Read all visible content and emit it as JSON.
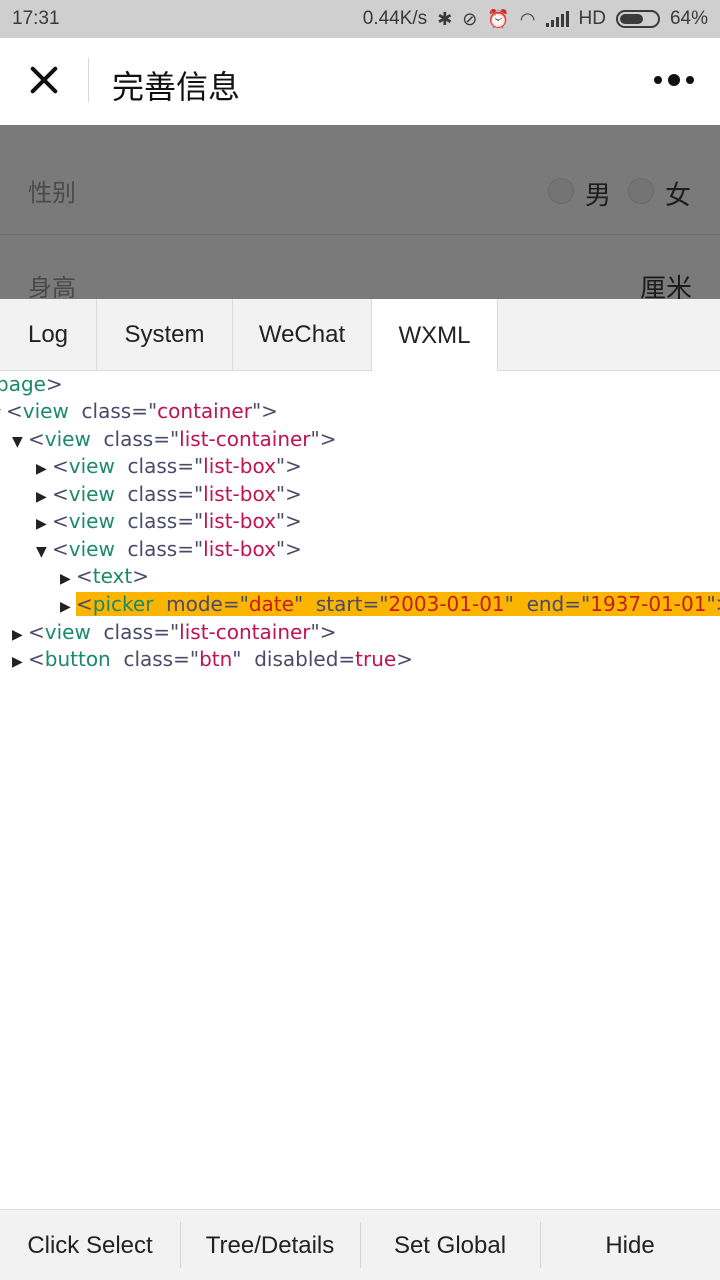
{
  "status_bar": {
    "time": "17:31",
    "speed": "0.44K/s",
    "network": "HD",
    "battery": "64%",
    "battery_level": 0.64,
    "icons": [
      "bluetooth-icon",
      "mute-icon",
      "alarm-icon",
      "wifi-icon",
      "signal-icon",
      "battery-icon"
    ]
  },
  "titlebar": {
    "title": "完善信息",
    "close_icon": "close-icon",
    "more_icon": "more-icon"
  },
  "form": {
    "gender_label": "性别",
    "male": "男",
    "female": "女",
    "height_label": "身高",
    "height_unit": "厘米"
  },
  "tabs": [
    {
      "label": "Log"
    },
    {
      "label": "System"
    },
    {
      "label": "WeChat"
    },
    {
      "label": "WXML"
    }
  ],
  "active_tab": "WXML",
  "tree": {
    "page": "page",
    "view": "view",
    "class_attr": "class",
    "container": "container",
    "list_container": "list-container",
    "list_box": "list-box",
    "text_tag": "text",
    "picker_tag": "picker",
    "mode_attr": "mode",
    "mode_val": "date",
    "start_attr": "start",
    "start_val": "2003-01-01",
    "end_attr": "end",
    "end_val": "1937-01-01",
    "button_tag": "button",
    "btn_val": "btn",
    "disabled_attr": "disabled",
    "disabled_val": "true"
  },
  "bottom": {
    "click_select": "Click Select",
    "tree_details": "Tree/Details",
    "set_global": "Set Global",
    "hide": "Hide"
  },
  "colors": {
    "highlight": "#fbb400",
    "tag": "#1a8a6a",
    "value": "#c0144c"
  }
}
